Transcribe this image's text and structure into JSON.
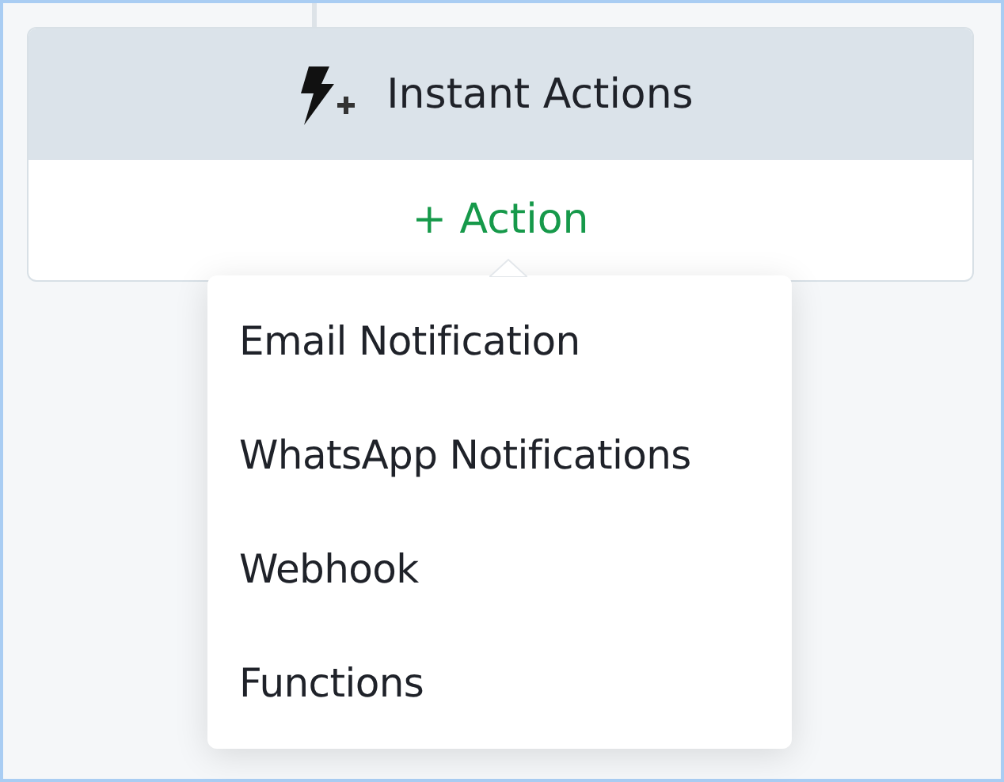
{
  "card": {
    "title": "Instant Actions",
    "add_button": "+ Action"
  },
  "menu": {
    "open": true,
    "items": [
      {
        "label": "Email Notification"
      },
      {
        "label": "WhatsApp Notifications"
      },
      {
        "label": "Webhook"
      },
      {
        "label": "Functions"
      }
    ]
  }
}
